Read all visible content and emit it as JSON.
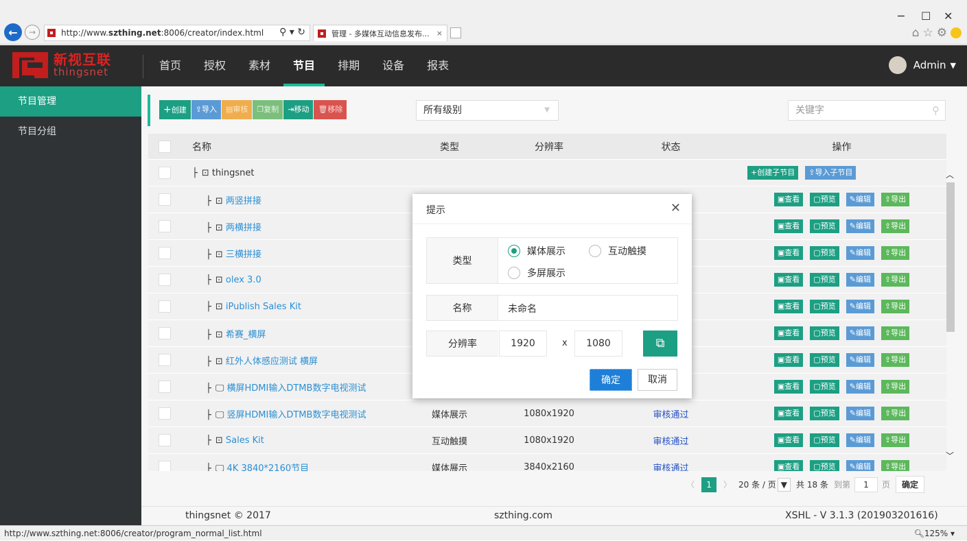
{
  "browser": {
    "url_prefix": "http://www.",
    "url_host": "szthing.net",
    "url_rest": ":8006/creator/index.html",
    "tab_title": "管理 - 多媒体互动信息发布...",
    "status_url": "http://www.szthing.net:8006/creator/program_normal_list.html",
    "zoom": "125%"
  },
  "header": {
    "logo_cn": "新视互联",
    "logo_en": "thingsnet",
    "nav": [
      "首页",
      "授权",
      "素材",
      "节目",
      "排期",
      "设备",
      "报表"
    ],
    "active_nav": 3,
    "user": "Admin"
  },
  "sidebar": {
    "items": [
      {
        "label": "节目管理",
        "active": true
      },
      {
        "label": "节目分组",
        "active": false
      }
    ]
  },
  "toolbar": {
    "create": "创建",
    "import": "导入",
    "review": "审核",
    "copy": "复制",
    "move": "移动",
    "remove": "移除",
    "level_select": "所有级别",
    "search_placeholder": "关键字"
  },
  "table": {
    "headers": {
      "name": "名称",
      "type": "类型",
      "resolution": "分辨率",
      "status": "状态",
      "ops": "操作"
    },
    "root": {
      "name": "thingsnet",
      "add_child": "创建子节目",
      "import_child": "导入子节目"
    },
    "op_labels": {
      "view": "查看",
      "preview": "预览",
      "edit": "编辑",
      "export": "导出"
    },
    "rows": [
      {
        "name": "两竖拼接",
        "type": "",
        "resolution": "",
        "status": "",
        "icon": "interactive"
      },
      {
        "name": "两横拼接",
        "type": "",
        "resolution": "",
        "status": "",
        "icon": "interactive"
      },
      {
        "name": "三横拼接",
        "type": "",
        "resolution": "",
        "status": "",
        "icon": "interactive"
      },
      {
        "name": "olex 3.0",
        "type": "",
        "resolution": "",
        "status": "",
        "icon": "interactive"
      },
      {
        "name": "iPublish Sales Kit",
        "type": "",
        "resolution": "",
        "status": "",
        "icon": "interactive"
      },
      {
        "name": "希赛_横屏",
        "type": "",
        "resolution": "",
        "status": "",
        "icon": "interactive"
      },
      {
        "name": "红外人体感应测试 横屏",
        "type": "",
        "resolution": "",
        "status": "",
        "icon": "interactive"
      },
      {
        "name": "横屏HDMI输入DTMB数字电视测试",
        "type": "",
        "resolution": "",
        "status": "",
        "icon": "media"
      },
      {
        "name": "竖屏HDMI输入DTMB数字电视测试",
        "type": "媒体展示",
        "resolution": "1080x1920",
        "status": "审核通过",
        "icon": "media"
      },
      {
        "name": "Sales Kit",
        "type": "互动触摸",
        "resolution": "1080x1920",
        "status": "审核通过",
        "icon": "interactive"
      },
      {
        "name": "4K 3840*2160节目",
        "type": "媒体展示",
        "resolution": "3840x2160",
        "status": "审核通过",
        "icon": "media"
      }
    ]
  },
  "pagination": {
    "current": "1",
    "page_size": "20 条 / 页",
    "total": "共 18 条",
    "goto_label": "到第",
    "goto_value": "1",
    "page_unit": "页",
    "confirm": "确定"
  },
  "footer": {
    "left": "thingsnet © 2017",
    "center": "szthing.com",
    "right": "XSHL - V 3.1.3 (201903201616)"
  },
  "modal": {
    "title": "提示",
    "type_label": "类型",
    "type_options": [
      "媒体展示",
      "互动触摸",
      "多屏展示"
    ],
    "type_selected": 0,
    "name_label": "名称",
    "name_value": "未命名",
    "res_label": "分辨率",
    "res_width": "1920",
    "res_x": "x",
    "res_height": "1080",
    "ok": "确定",
    "cancel": "取消"
  }
}
